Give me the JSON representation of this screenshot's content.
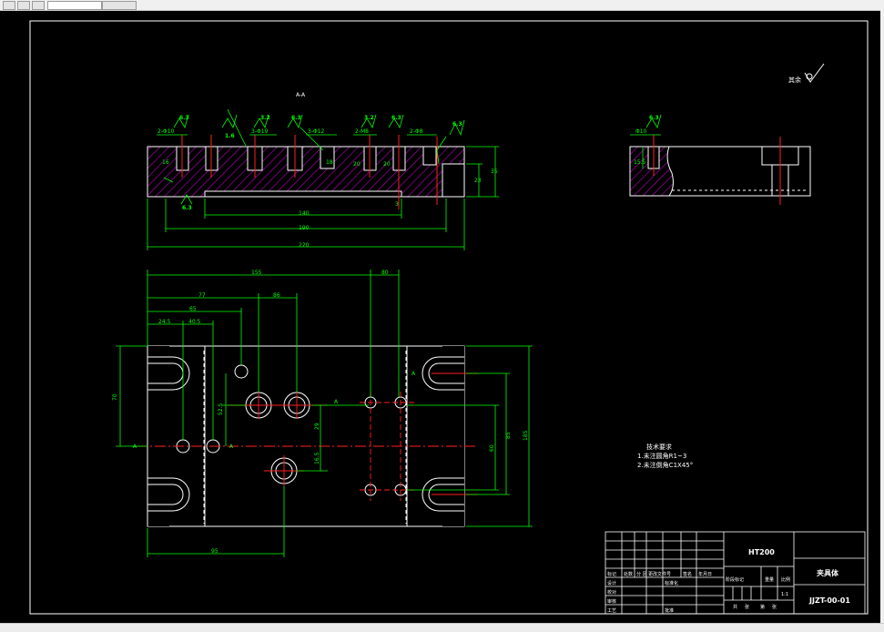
{
  "colors": {
    "background": "#000000",
    "outline": "#ffffff",
    "dimension": "#00ff00",
    "centerline": "#ff2020",
    "hatch": "#c000c0",
    "border": "#ffffff"
  },
  "top_view": {
    "section_label": "A-A",
    "hole_labels": [
      "2-Φ10",
      "3-Φ19",
      "3-Φ12",
      "2-M8",
      "2-Φ8"
    ],
    "roughness": [
      "6.3",
      "1.6",
      "3.2",
      "6.3",
      "3.2",
      "6.3",
      "6.3",
      "6.3"
    ],
    "depth_labels": [
      "16",
      "18",
      "20",
      "20"
    ],
    "dims": {
      "d140": "140",
      "d190": "190",
      "d220": "220",
      "h23": "23",
      "h35": "35",
      "d3": "3"
    }
  },
  "side_view": {
    "hole_label": "Φ10",
    "depth": "15.5",
    "roughness": "6.3"
  },
  "corner_roughness": "其余",
  "plan_view": {
    "dims": {
      "d155": "155",
      "d80": "80",
      "d77": "77",
      "d65": "65",
      "d86": "86",
      "d24_5": "24.5",
      "d40_5": "40.5",
      "d70": "70",
      "d52_5": "52.5",
      "d29": "29",
      "d16_5": "16.5",
      "d85": "85",
      "d60": "60",
      "d185": "185",
      "d95": "95"
    },
    "section_marks": [
      "A",
      "A",
      "A",
      "A"
    ]
  },
  "tech_req": {
    "title": "技术要求",
    "items": [
      "1.未注圆角R1~3",
      "2.未注倒角C1X45°"
    ]
  },
  "title_block": {
    "material": "HT200",
    "part_name": "夹具体",
    "drawing_no": "JJZT-00-01",
    "scale": "1:1",
    "headers": [
      "标记",
      "处数",
      "分 区",
      "更改文件号",
      "签名",
      "年月日"
    ],
    "rows": [
      "设计",
      "校对",
      "审核",
      "工艺"
    ],
    "std": "标准化",
    "stage": "阶段标记",
    "weight": "重量",
    "scale_label": "比例",
    "sheet": [
      "共",
      "张",
      "第",
      "张"
    ],
    "approve": "批准"
  }
}
